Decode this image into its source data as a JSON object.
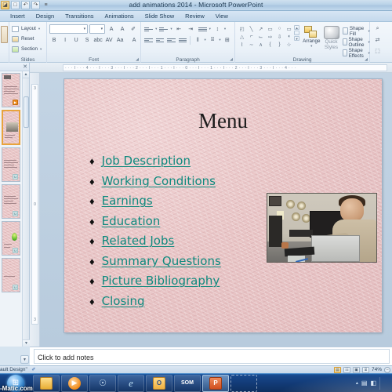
{
  "window": {
    "title": "add animations 2014 - Microsoft PowerPoint",
    "qat": [
      {
        "name": "save-icon",
        "glyph": "◪"
      },
      {
        "name": "new-document-icon",
        "glyph": "□"
      },
      {
        "name": "undo-icon",
        "glyph": "↶"
      },
      {
        "name": "redo-icon",
        "glyph": "↷"
      },
      {
        "name": "customize-qat-icon",
        "glyph": "≡"
      }
    ]
  },
  "tabs": [
    {
      "label": "Insert",
      "active": false
    },
    {
      "label": "Design",
      "active": false
    },
    {
      "label": "Transitions",
      "active": false
    },
    {
      "label": "Animations",
      "active": false
    },
    {
      "label": "Slide Show",
      "active": false
    },
    {
      "label": "Review",
      "active": false
    },
    {
      "label": "View",
      "active": false
    }
  ],
  "ribbon": {
    "groups": {
      "clipboard": {
        "label": ""
      },
      "slides": {
        "label": "Slides",
        "new_slide": "",
        "layout": "Layout",
        "reset": "Reset",
        "section": "Section"
      },
      "font": {
        "label": "Font",
        "font_name_value": "",
        "font_size_value": "",
        "grow_font": "A",
        "shrink_font": "A",
        "clear_formatting": "✐",
        "bold": "B",
        "italic": "I",
        "underline": "U",
        "shadow": "S",
        "strikethrough": "abc",
        "character_spacing": "AV",
        "change_case": "Aa",
        "font_color": "A"
      },
      "paragraph": {
        "label": "Paragraph",
        "bullets": "≣",
        "numbering": "≣",
        "decrease_indent": "⇤",
        "increase_indent": "⇥",
        "line_spacing": "≣",
        "text_direction": "↕",
        "align_text": "⌸",
        "convert_to_smartart": "⊞",
        "align_left": "≡",
        "center": "≡",
        "align_right": "≡",
        "justify": "≡",
        "columns": "‖"
      },
      "drawing": {
        "label": "Drawing",
        "shapes": [
          "◰",
          "╲",
          "↗",
          "▭",
          "○",
          "▭",
          "△",
          "⌐",
          "⌙",
          "⇨",
          "⇩",
          "◖",
          "⌇",
          "∼",
          "∧",
          "{",
          "}",
          "☆"
        ],
        "arrange": "Arrange",
        "quick_styles": "Quick Styles",
        "shape_fill": "Shape Fill",
        "shape_outline": "Shape Outline",
        "shape_effects": "Shape Effects"
      },
      "editing": {
        "label": "",
        "find": "⌕",
        "replace": "⇄",
        "select": "⬚"
      }
    }
  },
  "slides_panel": {
    "close_glyph": "✕",
    "scroll_up": "▲",
    "scroll_down": "▼",
    "thumbnails": [
      {
        "name": "slide-thumbnail-1",
        "selected": false,
        "has_photo": false,
        "badge": "▶",
        "badge_style": "orange",
        "has_green": false
      },
      {
        "name": "slide-thumbnail-2",
        "selected": true,
        "has_photo": true,
        "badge": "",
        "badge_style": "",
        "has_green": false
      },
      {
        "name": "slide-thumbnail-3",
        "selected": false,
        "has_photo": false,
        "badge": "U",
        "badge_style": "",
        "has_green": false
      },
      {
        "name": "slide-thumbnail-4",
        "selected": false,
        "has_photo": false,
        "badge": "U",
        "badge_style": "",
        "has_green": false
      },
      {
        "name": "slide-thumbnail-5",
        "selected": false,
        "has_photo": false,
        "badge": "U",
        "badge_style": "",
        "has_green": true
      },
      {
        "name": "slide-thumbnail-6",
        "selected": false,
        "has_photo": false,
        "badge": "U",
        "badge_style": "",
        "has_green": false
      }
    ]
  },
  "rulers": {
    "horizontal": "· · · I · · · 4 · · · I · · · 3 · · · I · · · 2 · · · I · · · 1 · · · I · · · 0 · · · I · · · 1 · · · I · · · 2 · · · I · · · 3 · · · I · · · 4 · · ·",
    "vertical_top": "3",
    "vertical_mid": "0",
    "vertical_bottom": "3"
  },
  "slide": {
    "title": "Menu",
    "bullet_glyph": "♦",
    "link_color": "#0f8a7e",
    "background_color": "#e8c4c5",
    "items": [
      {
        "label": "Job Description"
      },
      {
        "label": "Working Conditions"
      },
      {
        "label": "Earnings"
      },
      {
        "label": "Education"
      },
      {
        "label": "Related Jobs"
      },
      {
        "label": "Summary Questions"
      },
      {
        "label": "Picture Bibliography"
      },
      {
        "label": "Closing"
      }
    ],
    "image": {
      "name": "man-at-computer-photo",
      "alt": "Man seated at desk working with computer equipment"
    }
  },
  "notes": {
    "placeholder": "Click to add notes",
    "collapse_glyph": "▼"
  },
  "statusbar": {
    "theme": "ault Design\"",
    "language_icon": "✐",
    "views": [
      {
        "name": "normal-view-button",
        "glyph": "▤",
        "active": true
      },
      {
        "name": "slide-sorter-view-button",
        "glyph": "☷",
        "active": false
      },
      {
        "name": "reading-view-button",
        "glyph": "▣",
        "active": false
      },
      {
        "name": "slide-show-button",
        "glyph": "⌸",
        "active": false
      }
    ],
    "zoom": "74%",
    "zoom_out_glyph": "−"
  },
  "taskbar": {
    "watermark": "-Matic.com",
    "start_glyph": "⊞",
    "items": [
      {
        "name": "taskbar-file-explorer",
        "icon_class": "i-folder",
        "glyph": "",
        "state": ""
      },
      {
        "name": "taskbar-media-player",
        "icon_class": "i-media",
        "glyph": "▶",
        "state": ""
      },
      {
        "name": "taskbar-satellite-app",
        "icon_class": "i-sat",
        "glyph": "☉",
        "state": ""
      },
      {
        "name": "taskbar-internet-explorer",
        "icon_class": "i-ie",
        "glyph": "e",
        "state": ""
      },
      {
        "name": "taskbar-outlook",
        "icon_class": "i-outlook",
        "glyph": "O",
        "state": ""
      },
      {
        "name": "taskbar-screencast-o-matic",
        "icon_class": "i-som",
        "glyph": "SOM",
        "state": ""
      },
      {
        "name": "taskbar-powerpoint",
        "icon_class": "i-ppt",
        "glyph": "P",
        "state": "active"
      },
      {
        "name": "taskbar-recording-region",
        "icon_class": "",
        "glyph": "",
        "state": "ghost"
      }
    ],
    "tray": {
      "caret": "▴",
      "network_icon": "▤",
      "volume_icon": "◧"
    }
  }
}
